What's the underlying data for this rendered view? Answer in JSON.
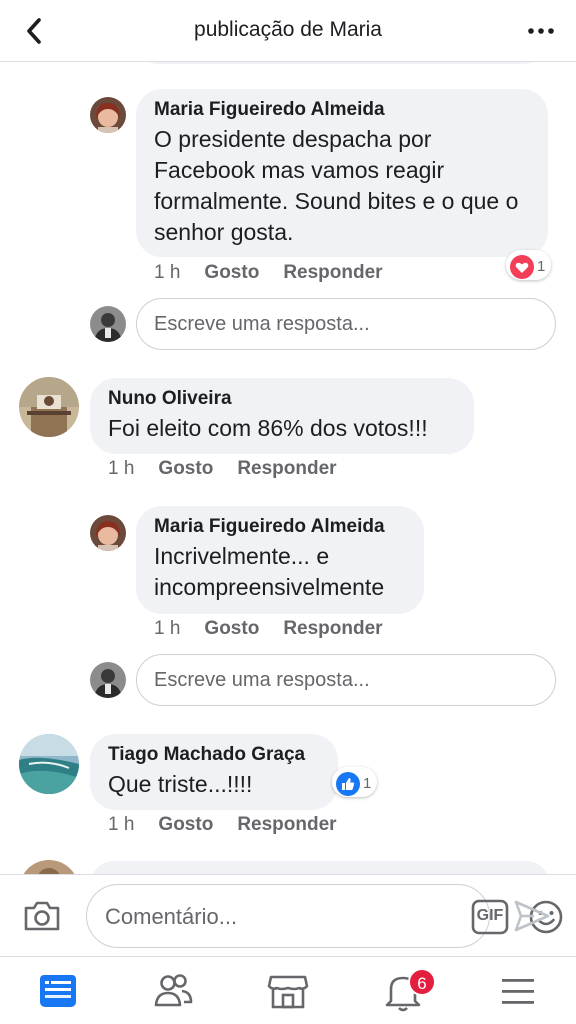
{
  "header": {
    "title": "publicação de Maria",
    "back_icon": "chevron-left-icon",
    "more_icon": "more-horizontal-icon"
  },
  "comments": [
    {
      "author": "Maria Figueiredo Almeida",
      "text": "O presidente despacha por Facebook mas vamos reagir formalmente. Sound bites e o que o senhor gosta.",
      "time": "1 h",
      "like_label": "Gosto",
      "reply_label": "Responder",
      "reaction": {
        "icon": "heart-reaction-icon",
        "color": "#f33e58",
        "count": "1"
      }
    },
    {
      "author": "Nuno Oliveira",
      "text": "Foi eleito com 86% dos votos!!!",
      "time": "1 h",
      "like_label": "Gosto",
      "reply_label": "Responder"
    },
    {
      "author": "Maria Figueiredo Almeida",
      "text": "Incrivelmente... e incompreensivelmente",
      "time": "1 h",
      "like_label": "Gosto",
      "reply_label": "Responder"
    },
    {
      "author": "Tiago Machado Graça",
      "text": "Que triste...!!!!",
      "time": "1 h",
      "like_label": "Gosto",
      "reply_label": "Responder",
      "reaction": {
        "icon": "like-reaction-icon",
        "color": "#1877f2",
        "count": "1"
      }
    }
  ],
  "reply_input": {
    "placeholder": "Escreve uma resposta..."
  },
  "composer": {
    "placeholder": "Comentário...",
    "gif_label": "GIF",
    "camera_icon": "camera-icon",
    "emoji_icon": "emoji-icon",
    "send_icon": "send-icon"
  },
  "tabbar": {
    "items": [
      "news-feed-icon",
      "friends-icon",
      "marketplace-icon",
      "notifications-icon",
      "menu-icon"
    ],
    "notification_count": "6",
    "active_color": "#1877f2"
  }
}
